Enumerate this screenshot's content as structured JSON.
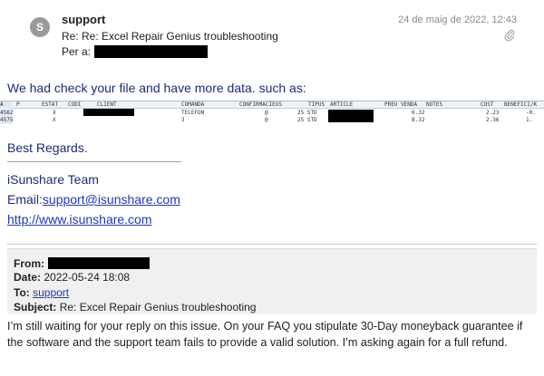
{
  "header": {
    "avatar_initial": "S",
    "sender": "support",
    "date": "24 de maig de 2022, 12:43",
    "subject": "Re: Re: Excel Repair Genius troubleshooting",
    "to_label": "Per a:"
  },
  "body": {
    "intro": "We had check your file and have more data. such as:",
    "spreadsheet": {
      "headers": [
        "A",
        "P",
        "ESTAT",
        "CODI",
        "CLIENT",
        "COMANDA",
        "CONFIRMACIEGS",
        "TIPUS",
        "ARTICLE",
        "PREU VENDA",
        "NOTES",
        "COST",
        "BENEFICI/K"
      ],
      "rows": [
        {
          "a": "4562",
          "p": "X",
          "comanda": "TELEFON",
          "conf": "@",
          "tipus": "25 STD",
          "preu": "6.32",
          "cost": "2.23",
          "benefici": "-0."
        },
        {
          "a": "4575",
          "p": "X",
          "comanda": "3",
          "conf": "@",
          "tipus": "25 STD",
          "preu": "8.32",
          "cost": "2.36",
          "benefici": "1."
        }
      ]
    },
    "regards": "Best Regards.",
    "team": "iSunshare Team",
    "email_label": "Email:",
    "email": "support@isunshare.com",
    "website": "http://www.isunshare.com"
  },
  "quoted": {
    "from_label": "From:",
    "date_label": "Date:",
    "date_value": "2022-05-24 18:08",
    "to_label": "To:",
    "to_value": "support",
    "subject_label": "Subject:",
    "subject_value": "Re: Excel Repair Genius troubleshooting"
  },
  "message": "I’m still waiting for your reply on this issue. On your FAQ you stipulate 30-Day moneyback guarantee if the software and the support team fails to provide a valid solution. I’m asking again for a full refund.",
  "colors": {
    "signature_blue": "#1f2a7a",
    "link_blue": "#1a37c9",
    "quote_bg": "#f0f0f0"
  }
}
